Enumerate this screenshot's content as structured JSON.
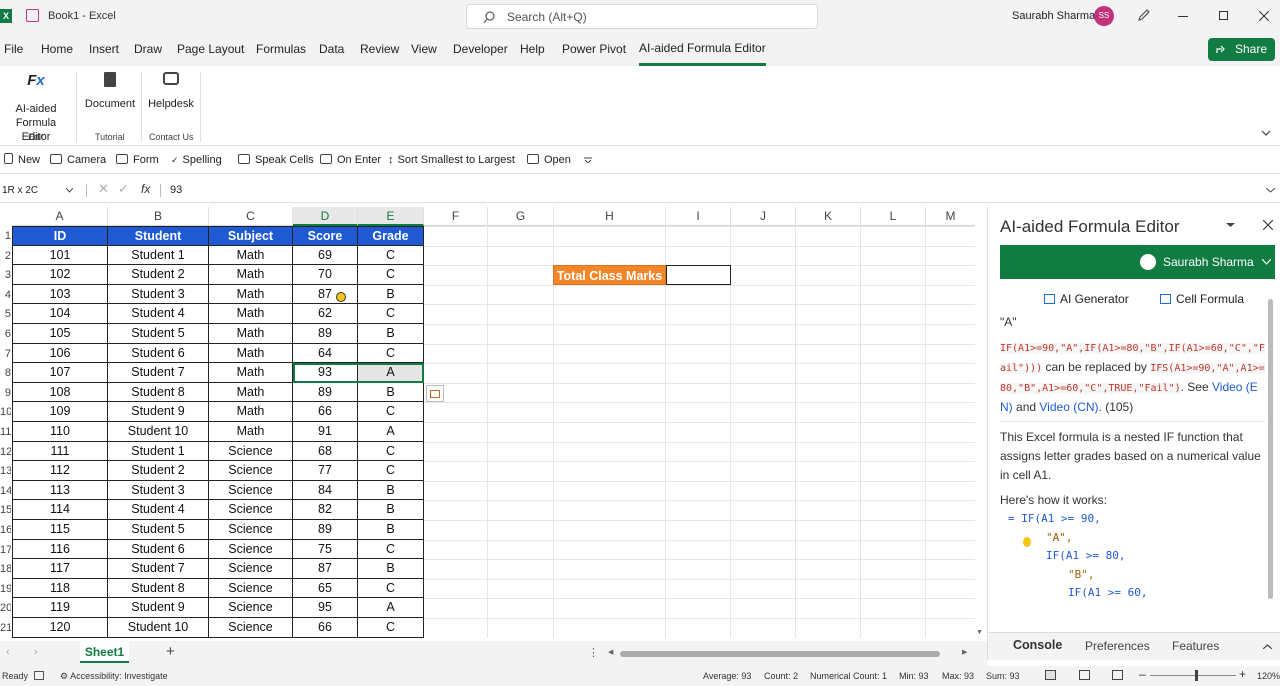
{
  "titlebar": {
    "app_icon": "X",
    "doc_title": "Book1 - Excel",
    "search_placeholder": "Search (Alt+Q)",
    "user_name": "Saurabh Sharma",
    "user_initials": "SS"
  },
  "tabs": [
    "File",
    "Home",
    "Insert",
    "Draw",
    "Page Layout",
    "Formulas",
    "Data",
    "Review",
    "View",
    "Developer",
    "Help",
    "Power Pivot",
    "AI-aided Formula Editor"
  ],
  "share_label": "Share",
  "ribbon": {
    "groups": [
      {
        "buttons": [
          {
            "label": "AI-aided Formula Editor",
            "icon": "fx-icon"
          }
        ],
        "label": "Edit"
      },
      {
        "buttons": [
          {
            "label": "Document",
            "icon": "document-icon"
          }
        ],
        "label": "Tutorial"
      },
      {
        "buttons": [
          {
            "label": "Helpdesk",
            "icon": "chat-icon"
          }
        ],
        "label": "Contact Us"
      }
    ]
  },
  "qat": [
    "New",
    "Camera",
    "Form",
    "Spelling",
    "Speak Cells",
    "On Enter",
    "Sort Smallest to Largest",
    "Open"
  ],
  "formula_bar": {
    "name_box": "1R x 2C",
    "value": "93"
  },
  "columns": [
    "A",
    "B",
    "C",
    "D",
    "E",
    "F",
    "G",
    "H",
    "I",
    "J",
    "K",
    "L",
    "M"
  ],
  "table": {
    "headers": [
      "ID",
      "Student",
      "Subject",
      "Score",
      "Grade"
    ],
    "rows": [
      [
        "101",
        "Student 1",
        "Math",
        "69",
        "C"
      ],
      [
        "102",
        "Student 2",
        "Math",
        "70",
        "C"
      ],
      [
        "103",
        "Student 3",
        "Math",
        "87",
        "B"
      ],
      [
        "104",
        "Student 4",
        "Math",
        "62",
        "C"
      ],
      [
        "105",
        "Student 5",
        "Math",
        "89",
        "B"
      ],
      [
        "106",
        "Student 6",
        "Math",
        "64",
        "C"
      ],
      [
        "107",
        "Student 7",
        "Math",
        "93",
        "A"
      ],
      [
        "108",
        "Student 8",
        "Math",
        "89",
        "B"
      ],
      [
        "109",
        "Student 9",
        "Math",
        "66",
        "C"
      ],
      [
        "110",
        "Student 10",
        "Math",
        "91",
        "A"
      ],
      [
        "111",
        "Student 1",
        "Science",
        "68",
        "C"
      ],
      [
        "112",
        "Student 2",
        "Science",
        "77",
        "C"
      ],
      [
        "113",
        "Student 3",
        "Science",
        "84",
        "B"
      ],
      [
        "114",
        "Student 4",
        "Science",
        "82",
        "B"
      ],
      [
        "115",
        "Student 5",
        "Science",
        "89",
        "B"
      ],
      [
        "116",
        "Student 6",
        "Science",
        "75",
        "C"
      ],
      [
        "117",
        "Student 7",
        "Science",
        "87",
        "B"
      ],
      [
        "118",
        "Student 8",
        "Science",
        "65",
        "C"
      ],
      [
        "119",
        "Student 9",
        "Science",
        "95",
        "A"
      ],
      [
        "120",
        "Student 10",
        "Science",
        "66",
        "C"
      ]
    ],
    "row_numbers": [
      "1",
      "2",
      "3",
      "4",
      "5",
      "6",
      "7",
      "8",
      "9",
      "10",
      "11",
      "12",
      "13",
      "14",
      "15",
      "16",
      "17",
      "18",
      "19",
      "20",
      "21"
    ]
  },
  "total_label": "Total Class Marks",
  "panel": {
    "title": "AI-aided Formula Editor",
    "user": "Saurabh Sharma",
    "tabs": [
      "AI Generator",
      "Cell Formula"
    ],
    "quote": "\"A\"",
    "formula1": "IF(A1>=90,\"A\",IF(A1>=80,\"B\",IF(A1>=60,\"C\",\"Fail\")))",
    "replaced_text": "can be replaced by",
    "formula2": "IFS(A1>=90,\"A\",A1>=80,\"B\",A1>=60,\"C\",TRUE,\"Fail\")",
    "see_text": ". See",
    "video_en": "Video (EN)",
    "and_text": "and",
    "video_cn": "Video (CN)",
    "count_text": ". (105)",
    "desc": "This Excel formula is a nested IF function that assigns letter grades based on a numerical value in cell A1.",
    "how": "Here's how it works:",
    "code_lines": [
      "= IF(A1 >= 90,",
      "\"A\",",
      "IF(A1 >= 80,",
      "\"B\",",
      "IF(A1 >= 60,"
    ],
    "bottom_tabs": [
      "Console",
      "Preferences",
      "Features"
    ]
  },
  "sheet_tab": "Sheet1",
  "status": {
    "ready": "Ready",
    "accessibility": "Accessibility: Investigate",
    "average": "Average: 93",
    "count": "Count: 2",
    "numerical_count": "Numerical Count: 1",
    "min": "Min: 93",
    "max": "Max: 93",
    "sum": "Sum: 93",
    "zoom": "120%"
  }
}
